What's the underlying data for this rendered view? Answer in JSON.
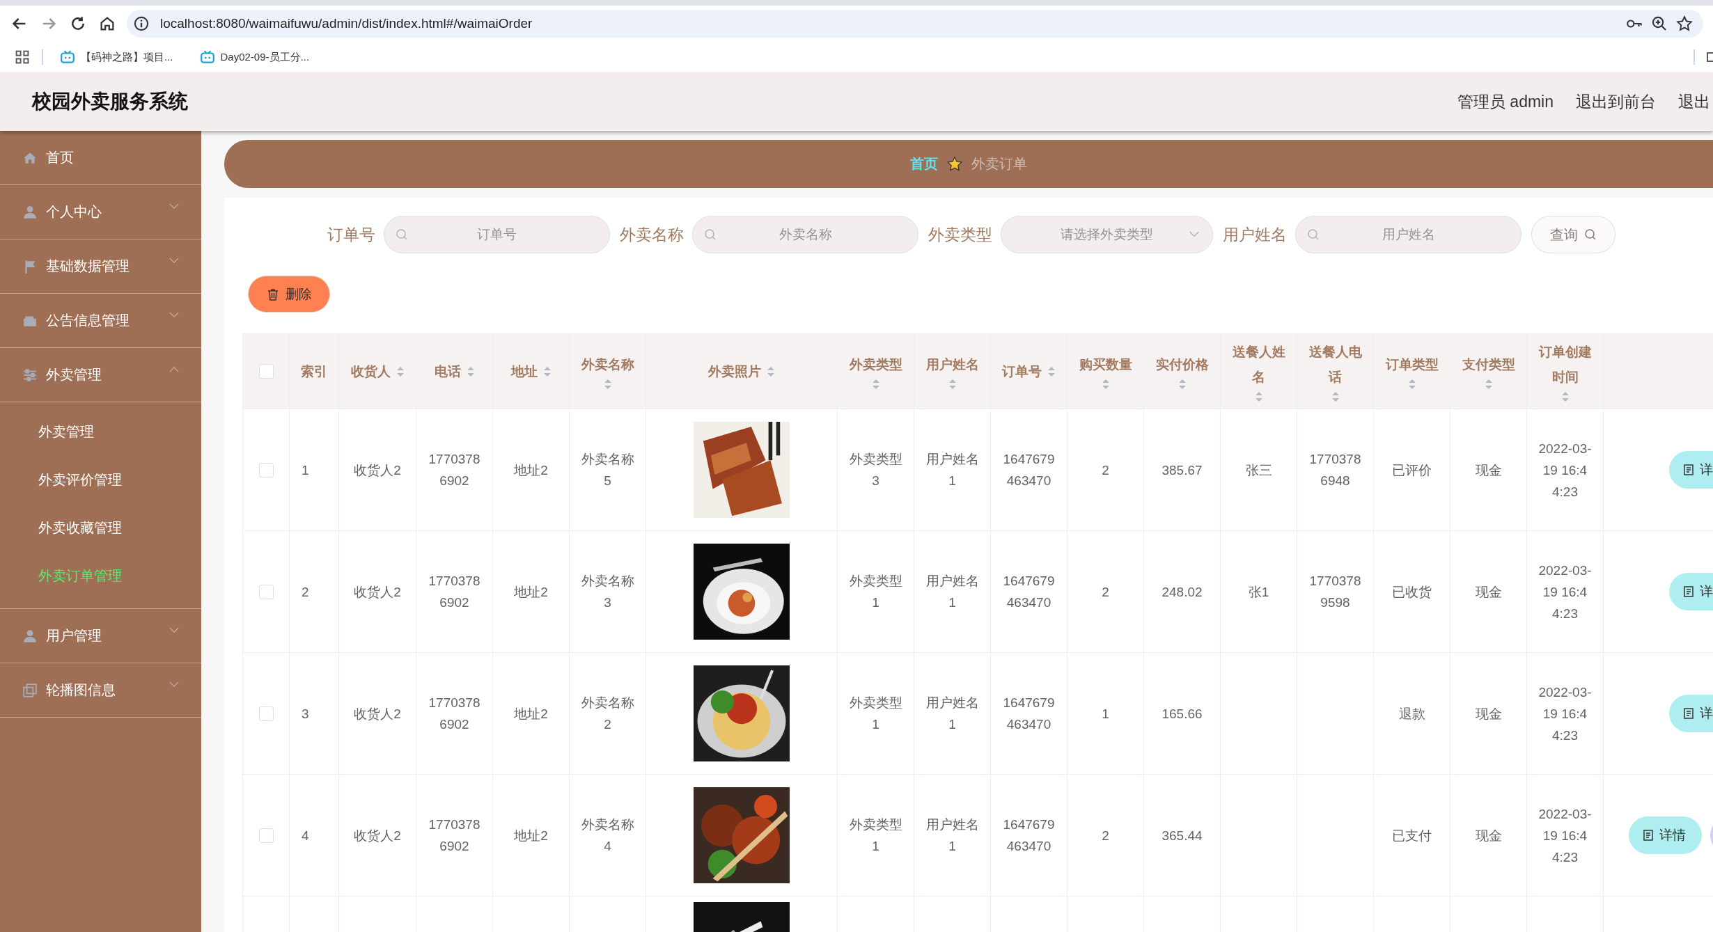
{
  "browser": {
    "url": "localhost:8080/waimaifuwu/admin/dist/index.html#/waimaiOrder",
    "bookmarks": [
      "【码神之路】项目...",
      "Day02-09-员工分..."
    ]
  },
  "header": {
    "title": "校园外卖服务系统",
    "links": [
      "管理员 admin",
      "退出到前台",
      "退出"
    ]
  },
  "sidebar": {
    "items": [
      {
        "label": "首页",
        "has_children": false
      },
      {
        "label": "个人中心",
        "expanded": false,
        "has_children": true
      },
      {
        "label": "基础数据管理",
        "expanded": false,
        "has_children": true
      },
      {
        "label": "公告信息管理",
        "expanded": false,
        "has_children": true
      },
      {
        "label": "外卖管理",
        "expanded": true,
        "has_children": true,
        "children": [
          {
            "label": "外卖管理",
            "selected": false
          },
          {
            "label": "外卖评价管理",
            "selected": false
          },
          {
            "label": "外卖收藏管理",
            "selected": false
          },
          {
            "label": "外卖订单管理",
            "selected": true
          }
        ]
      },
      {
        "label": "用户管理",
        "expanded": false,
        "has_children": true
      },
      {
        "label": "轮播图信息",
        "expanded": false,
        "has_children": true
      }
    ]
  },
  "breadcrumb": {
    "home": "首页",
    "current": "外卖订单"
  },
  "search": {
    "fields": [
      {
        "kind": "input",
        "label": "订单号",
        "placeholder": "订单号"
      },
      {
        "kind": "input",
        "label": "外卖名称",
        "placeholder": "外卖名称"
      },
      {
        "kind": "select",
        "label": "外卖类型",
        "placeholder": "请选择外卖类型"
      },
      {
        "kind": "input",
        "label": "用户姓名",
        "placeholder": "用户姓名"
      }
    ],
    "button": "查询"
  },
  "delete_button": "删除",
  "table": {
    "select_all_checked": false,
    "columns": [
      {
        "label": "索引",
        "sortable": false
      },
      {
        "label": "收货人",
        "sortable": true
      },
      {
        "label": "电话",
        "sortable": true
      },
      {
        "label": "地址",
        "sortable": true
      },
      {
        "label": "外卖名称",
        "sortable": true
      },
      {
        "label": "外卖照片",
        "sortable": true
      },
      {
        "label": "外卖类型",
        "sortable": true
      },
      {
        "label": "用户姓名",
        "sortable": true
      },
      {
        "label": "订单号",
        "sortable": true
      },
      {
        "label": "购买数量",
        "sortable": true
      },
      {
        "label": "实付价格",
        "sortable": true
      },
      {
        "label": "送餐人姓名",
        "sortable": true
      },
      {
        "label": "送餐人电话",
        "sortable": true
      },
      {
        "label": "订单类型",
        "sortable": true
      },
      {
        "label": "支付类型",
        "sortable": true
      },
      {
        "label": "订单创建时间",
        "sortable": true
      }
    ],
    "rows": [
      {
        "checked": false,
        "cells": [
          "1",
          "收货人2",
          "17703786902",
          "地址2",
          "外卖名称5",
          {
            "kind": "picture"
          },
          "外卖类型3",
          "用户姓名1",
          "1647679463470",
          "2",
          "385.67",
          "张三",
          "17703786948",
          "已评价",
          "现金",
          "2022-03-19 16:44:23"
        ],
        "buttons": [
          {
            "label": "详"
          }
        ]
      },
      {
        "checked": false,
        "cells": [
          "2",
          "收货人2",
          "17703786902",
          "地址2",
          "外卖名称3",
          {
            "kind": "picture"
          },
          "外卖类型1",
          "用户姓名1",
          "1647679463470",
          "2",
          "248.02",
          "张1",
          "17703789598",
          "已收货",
          "现金",
          "2022-03-19 16:44:23"
        ],
        "buttons": [
          {
            "label": "详"
          }
        ]
      },
      {
        "checked": false,
        "cells": [
          "3",
          "收货人2",
          "17703786902",
          "地址2",
          "外卖名称2",
          {
            "kind": "picture"
          },
          "外卖类型1",
          "用户姓名1",
          "1647679463470",
          "1",
          "165.66",
          null,
          null,
          "退款",
          "现金",
          "2022-03-19 16:44:23"
        ],
        "buttons": [
          {
            "label": "详"
          }
        ]
      },
      {
        "checked": false,
        "cells": [
          "4",
          "收货人2",
          "17703786902",
          "地址2",
          "外卖名称4",
          {
            "kind": "picture"
          },
          "外卖类型1",
          "用户姓名1",
          "1647679463470",
          "2",
          "365.44",
          null,
          null,
          "已支付",
          "现金",
          "2022-03-19 16:44:23"
        ],
        "buttons": [
          {
            "label": "详情"
          },
          {
            "kind": "cut"
          }
        ]
      }
    ],
    "cut_row": {
      "photo": {
        "kind": "picture"
      }
    }
  }
}
